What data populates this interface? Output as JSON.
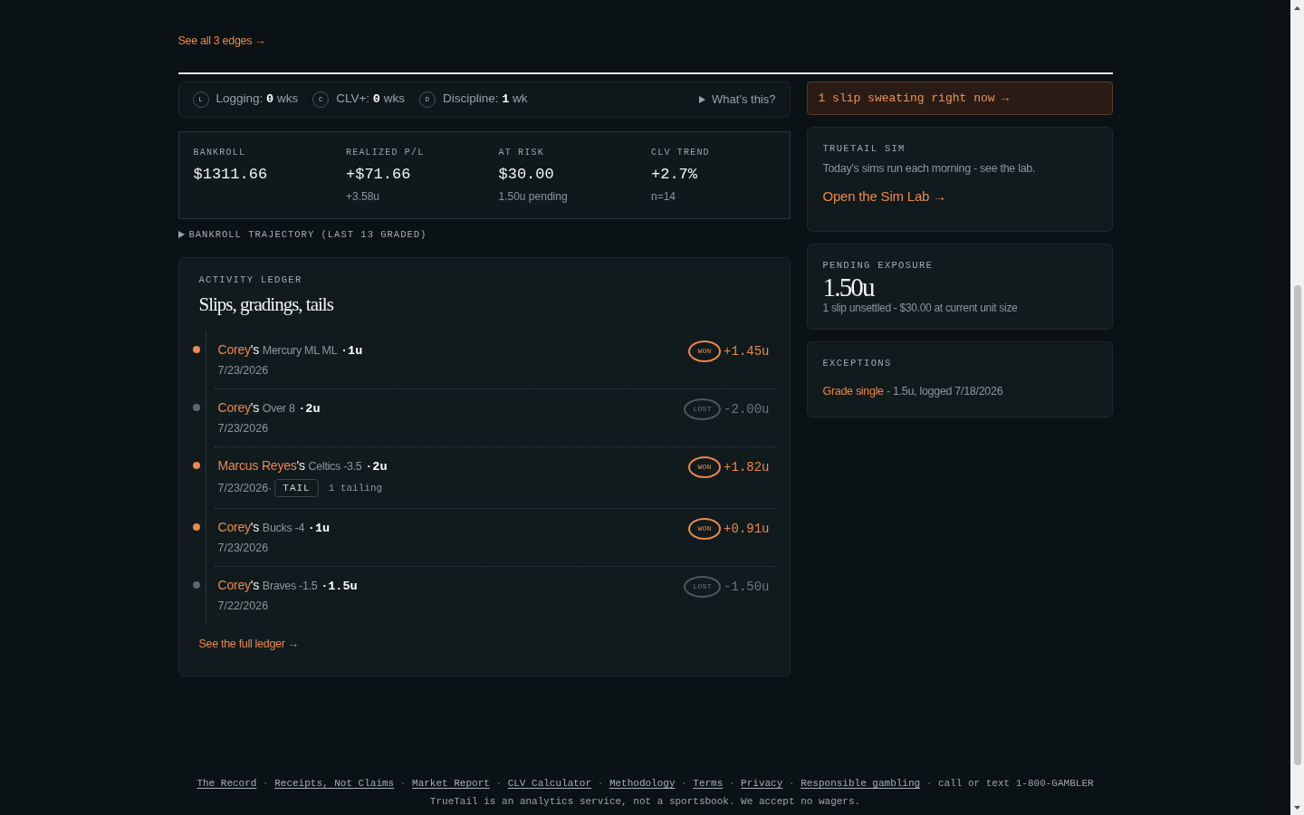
{
  "top_link": {
    "text": "See all 3 edges →"
  },
  "streaks": {
    "items": [
      {
        "badge": "L",
        "label": "Logging:",
        "value": "0",
        "unit": "wks"
      },
      {
        "badge": "C",
        "label": "CLV+:",
        "value": "0",
        "unit": "wks"
      },
      {
        "badge": "D",
        "label": "Discipline:",
        "value": "1",
        "unit": "wk"
      }
    ],
    "help": {
      "text": "What’s this?",
      "expanded": false
    }
  },
  "stats": [
    {
      "label": "BANKROLL",
      "value": "$1311.66"
    },
    {
      "label": "REALIZED P/L",
      "value": "+$71.66",
      "note": "+3.58u"
    },
    {
      "label": "AT RISK",
      "value": "$30.00",
      "note": "1.50u pending"
    },
    {
      "label": "CLV TREND",
      "value": "+2.7%",
      "note": "n=14"
    }
  ],
  "trajectory": {
    "text": "BANKROLL TRAJECTORY (LAST 13 GRADED)",
    "expanded": false
  },
  "ledger": {
    "eyebrow": "ACTIVITY LEDGER",
    "title": "Slips, gradings, tails",
    "entries": [
      {
        "kind": "won",
        "author": "Corey",
        "possessive": "'s",
        "pick": "Mercury ML ML",
        "stake": "·1u",
        "date": "7/23/2026",
        "result": "WON",
        "amount": "+1.45u"
      },
      {
        "kind": "lost",
        "author": "Corey",
        "possessive": "'s",
        "pick": "Over 8",
        "stake": "·2u",
        "date": "7/23/2026",
        "result": "LOST",
        "amount": "-2.00u"
      },
      {
        "kind": "won",
        "author": "Marcus Reyes",
        "possessive": "'s",
        "pick": "Celtics -3.5",
        "stake": "·2u",
        "date": "7/23/2026·",
        "tag": "TAIL",
        "tag_note": "1 tailing",
        "result": "WON",
        "amount": "+1.82u"
      },
      {
        "kind": "won",
        "author": "Corey",
        "possessive": "'s",
        "pick": "Bucks -4",
        "stake": "·1u",
        "date": "7/23/2026",
        "result": "WON",
        "amount": "+0.91u"
      },
      {
        "kind": "lost",
        "author": "Corey",
        "possessive": "'s",
        "pick": "Braves -1.5",
        "stake": "·1.5u",
        "date": "7/22/2026",
        "result": "LOST",
        "amount": "-1.50u"
      }
    ],
    "footer_link": "See the full ledger →"
  },
  "sweat_banner": {
    "text": "1 slip sweating right now →"
  },
  "sim": {
    "eyebrow": "TRUETAIL SIM",
    "text": "Today’s sims run each morning - see the lab.",
    "link": "Open the Sim Lab →"
  },
  "pending": {
    "eyebrow": "PENDING EXPOSURE",
    "value": "1.50u",
    "note": "1 slip unsettled - $30.00 at current unit size"
  },
  "exceptions": {
    "eyebrow": "EXCEPTIONS",
    "items": [
      {
        "link": "Grade single",
        "detail": " - 1.5u, logged 7/18/2026"
      }
    ]
  },
  "footer": {
    "items": [
      {
        "kind": "link",
        "text": "The Record"
      },
      {
        "kind": "separator",
        "text": "·"
      },
      {
        "kind": "link",
        "text": "Receipts, Not Claims"
      },
      {
        "kind": "separator",
        "text": "·"
      },
      {
        "kind": "link",
        "text": "Market Report"
      },
      {
        "kind": "separator",
        "text": "·"
      },
      {
        "kind": "link",
        "text": "CLV Calculator"
      },
      {
        "kind": "separator",
        "text": "·"
      },
      {
        "kind": "link",
        "text": "Methodology"
      },
      {
        "kind": "separator",
        "text": "·"
      },
      {
        "kind": "link",
        "text": "Terms"
      },
      {
        "kind": "separator",
        "text": "·"
      },
      {
        "kind": "link",
        "text": "Privacy"
      },
      {
        "kind": "separator",
        "text": "·"
      },
      {
        "kind": "link",
        "text": "Responsible gambling"
      },
      {
        "kind": "separator",
        "text": "·"
      },
      {
        "kind": "text",
        "text": "call or text 1-800-GAMBLER"
      }
    ],
    "disclaimer": "TrueTail is an analytics service, not a sportsbook. We accept no wagers."
  }
}
